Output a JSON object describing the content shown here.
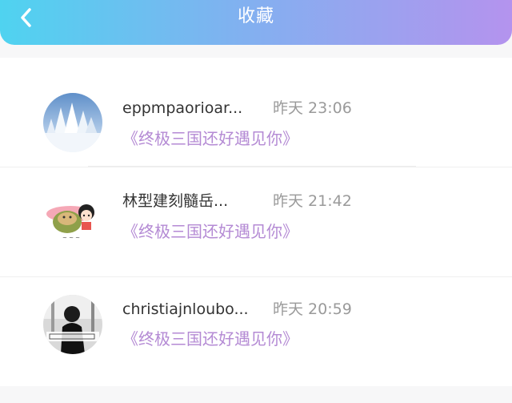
{
  "header": {
    "title": "收藏",
    "back_icon": "chevron-left-icon",
    "gradient": [
      "#4fd3f0",
      "#b493ee"
    ]
  },
  "favorites": [
    {
      "name": "eppmpaorioar...",
      "time": "昨天 23:06",
      "book": "《终极三国还好遇见你》",
      "avatar": "snowy-trees-avatar"
    },
    {
      "name": "林型建刻髓岳...",
      "time": "昨天 21:42",
      "book": "《终极三国还好遇见你》",
      "avatar": "cartoon-characters-avatar"
    },
    {
      "name": "christiajnloubo...",
      "time": "昨天 20:59",
      "book": "《终极三国还好遇见你》",
      "avatar": "bw-photo-avatar"
    }
  ],
  "colors": {
    "book_link": "#b48ad4",
    "time": "#9a9a9a",
    "name": "#333333"
  }
}
